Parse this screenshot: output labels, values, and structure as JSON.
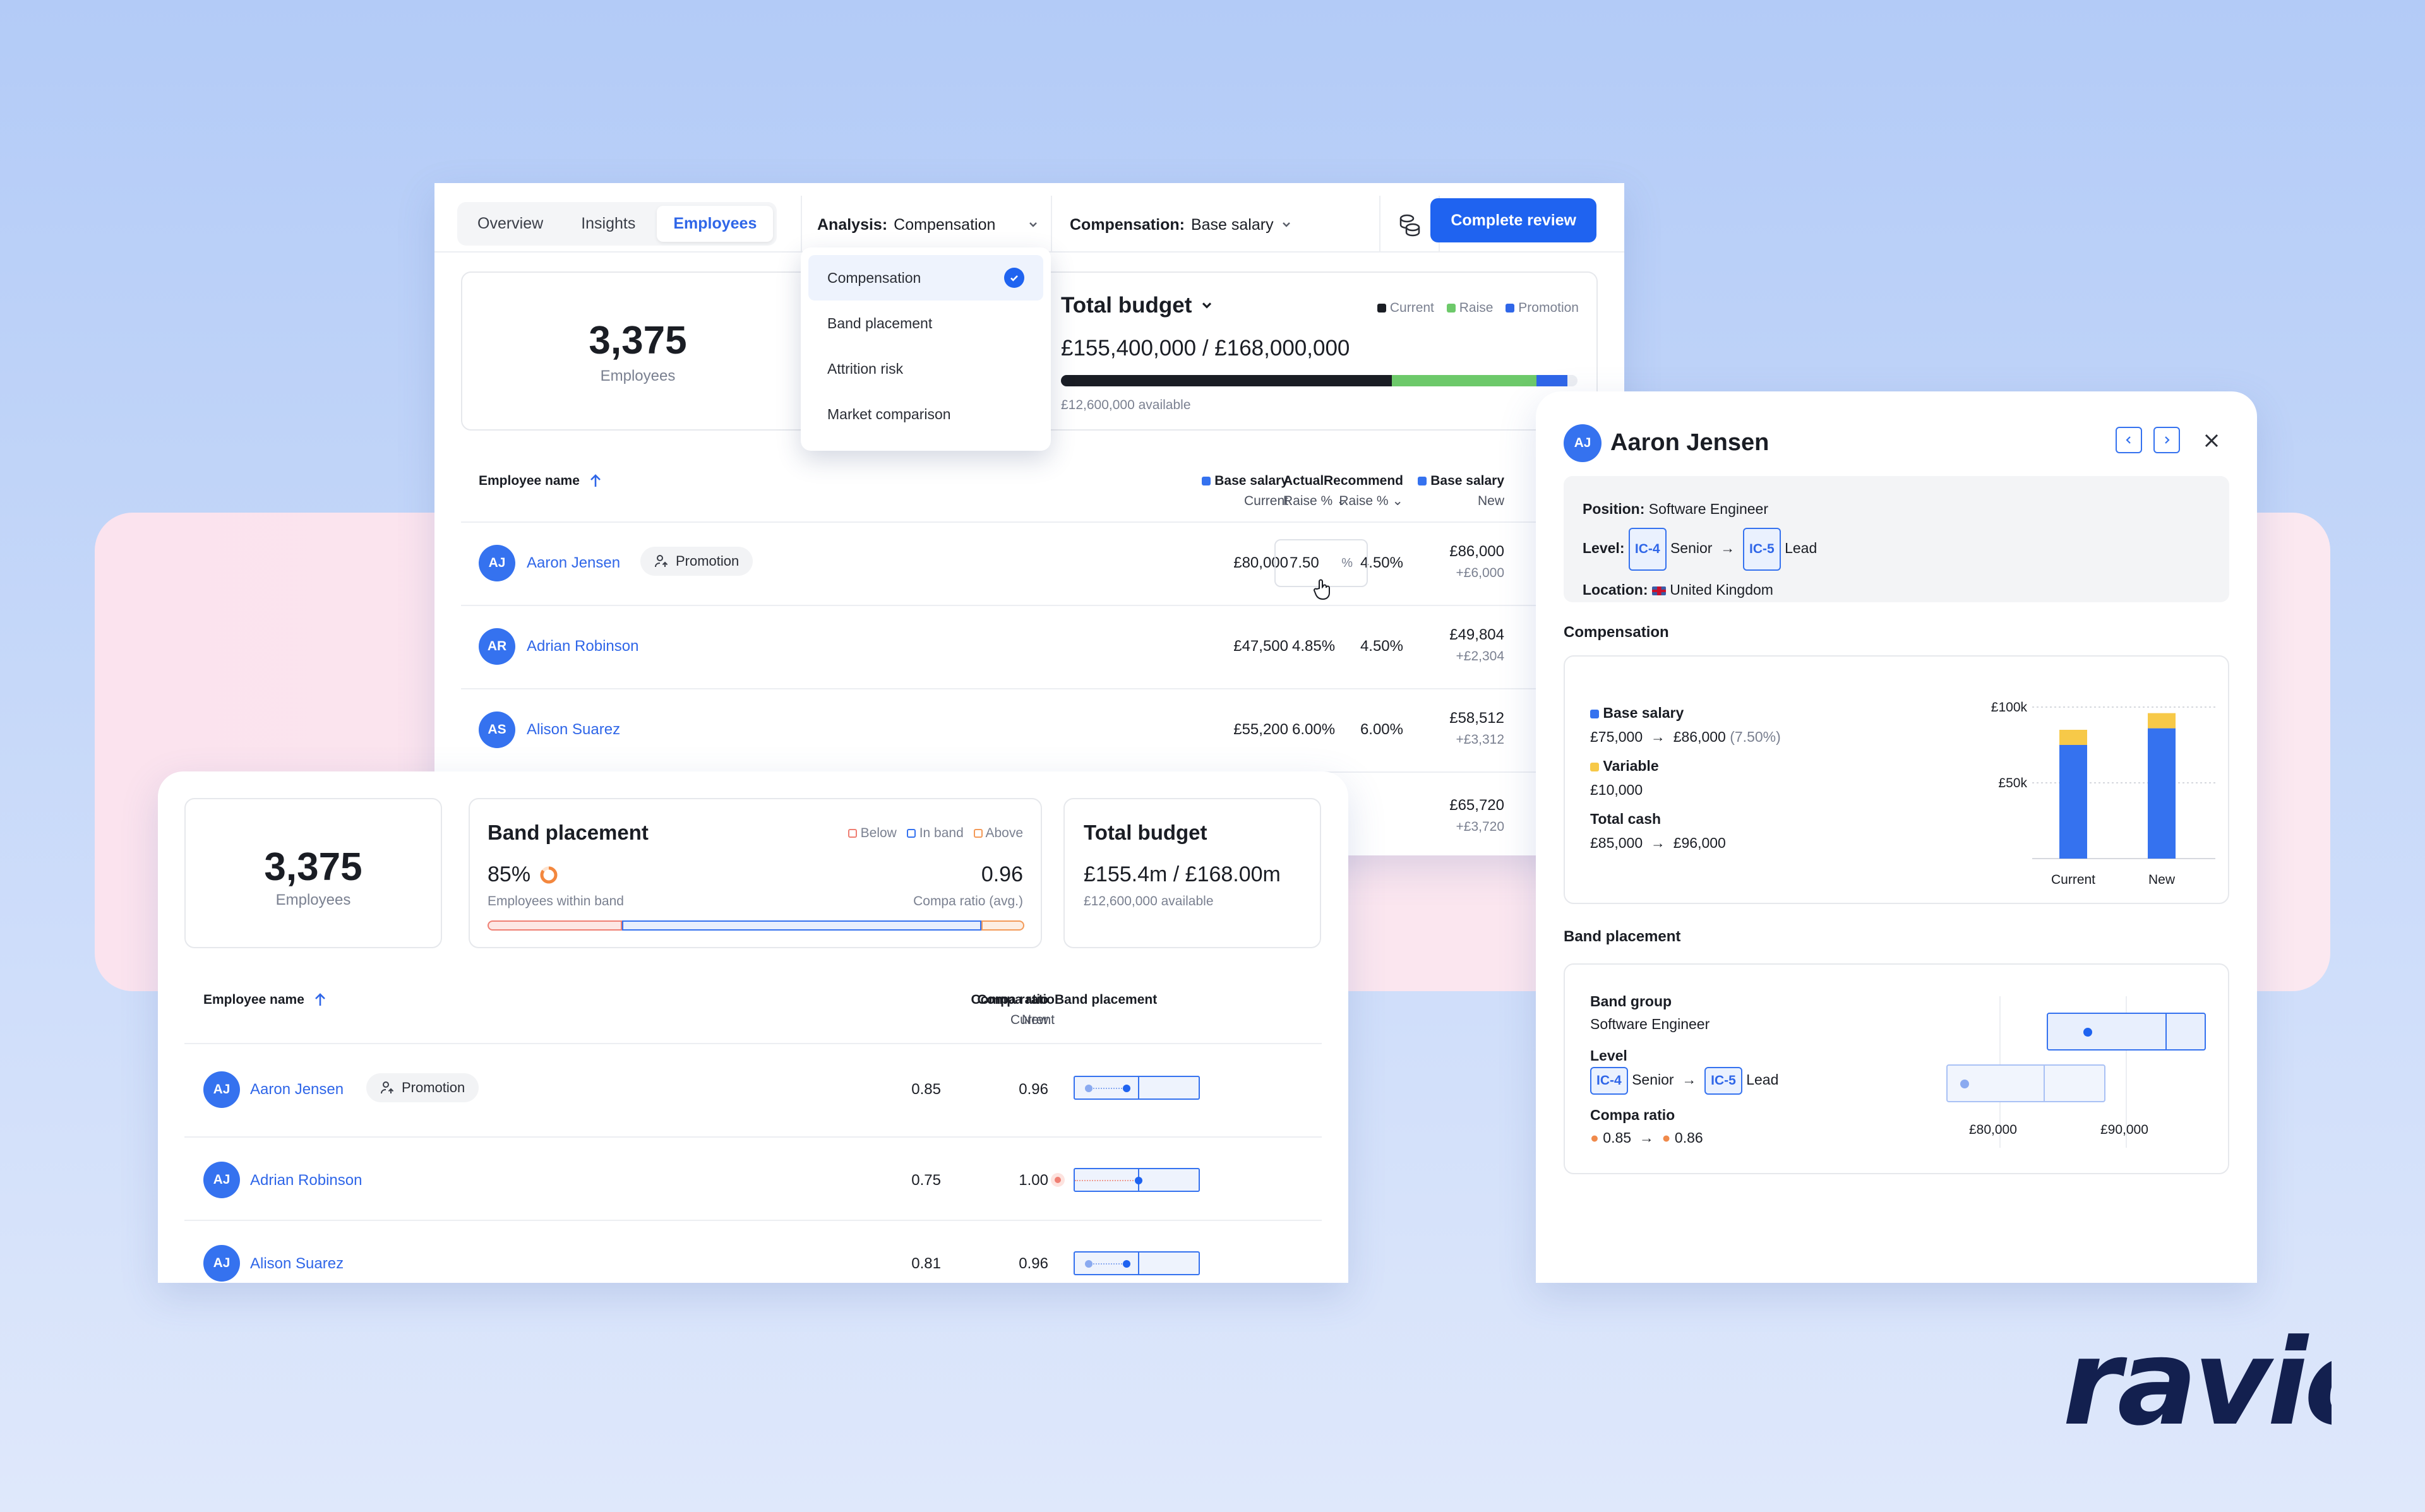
{
  "main": {
    "tabs": [
      "Overview",
      "Insights",
      "Employees"
    ],
    "active_tab": "Employees",
    "analysis_label": "Analysis:",
    "analysis_value": "Compensation",
    "compensation_label": "Compensation:",
    "compensation_value": "Base salary",
    "complete_button": "Complete review",
    "dropdown": [
      "Compensation",
      "Band placement",
      "Attrition risk",
      "Market comparison"
    ],
    "employees_count": "3,375",
    "employees_label": "Employees",
    "budget_title": "Total budget",
    "budget_amount": "£155,400,000 / £168,000,000",
    "budget_available": "£12,600,000 available",
    "legend": [
      "Current",
      "Raise",
      "Promotion"
    ],
    "budget_progress": {
      "current": 0.64,
      "raise": 0.28,
      "promotion": 0.06
    },
    "headers": {
      "name": "Employee name",
      "base_current_1": "Base salary",
      "base_current_2": "Current",
      "rec_1": "Recommend",
      "rec_2": "Raise %",
      "act_1": "Actual",
      "act_2": "Raise %",
      "base_new_1": "Base salary",
      "base_new_2": "New"
    },
    "rows": [
      {
        "initials": "AJ",
        "name": "Aaron Jensen",
        "badge": "Promotion",
        "current": "£80,000",
        "recommend": "4.50%",
        "actual": "7.50",
        "new": "£86,000",
        "delta": "+£6,000"
      },
      {
        "initials": "AR",
        "name": "Adrian Robinson",
        "current": "£47,500",
        "recommend": "4.50%",
        "actual": "4.85%",
        "new": "£49,804",
        "delta": "+£2,304"
      },
      {
        "initials": "AS",
        "name": "Alison Suarez",
        "current": "£55,200",
        "recommend": "6.00%",
        "actual": "6.00%",
        "new": "£58,512",
        "delta": "+£3,312"
      },
      {
        "new": "£65,720",
        "delta": "+£3,720"
      }
    ]
  },
  "band": {
    "employees_count": "3,375",
    "employees_label": "Employees",
    "placement_title": "Band placement",
    "placement_legend": [
      "Below",
      "In band",
      "Above"
    ],
    "within_pct": "85%",
    "within_label": "Employees within band",
    "compa_value": "0.96",
    "compa_label": "Compa ratio (avg.)",
    "budget_title": "Total budget",
    "budget_amount": "£155.4m / £168.00m",
    "budget_available": "£12,600,000 available",
    "headers": {
      "name": "Employee name",
      "cr_cur_1": "Compa ratio",
      "cr_cur_2": "Current",
      "cr_new_1": "Compa ratio",
      "cr_new_2": "New",
      "placement": "Band placement"
    },
    "rows": [
      {
        "initials": "AJ",
        "name": "Aaron Jensen",
        "badge": "Promotion",
        "current": "0.85",
        "new": "0.96"
      },
      {
        "initials": "AJ",
        "name": "Adrian Robinson",
        "current": "0.75",
        "new": "1.00"
      },
      {
        "initials": "AJ",
        "name": "Alison Suarez",
        "current": "0.81",
        "new": "0.96"
      }
    ]
  },
  "detail": {
    "initials": "AJ",
    "name": "Aaron Jensen",
    "position_label": "Position:",
    "position_value": "Software Engineer",
    "level_label": "Level:",
    "level_from_tag": "IC-4",
    "level_from": "Senior",
    "level_to_tag": "IC-5",
    "level_to": "Lead",
    "location_label": "Location:",
    "location_value": "United Kingdom",
    "compensation_title": "Compensation",
    "base_label": "Base salary",
    "base_from": "£75,000",
    "base_to": "£86,000",
    "base_pct": "(7.50%)",
    "variable_label": "Variable",
    "variable_value": "£10,000",
    "total_label": "Total cash",
    "total_from": "£85,000",
    "total_to": "£96,000",
    "band_title": "Band placement",
    "band_group_label": "Band group",
    "band_group_value": "Software Engineer",
    "level2_label": "Level",
    "compa_label": "Compa ratio",
    "compa_from": "0.85",
    "compa_to": "0.86",
    "axis_80": "£80,000",
    "axis_90": "£90,000"
  },
  "chart_data": {
    "type": "bar",
    "categories": [
      "Current",
      "New"
    ],
    "series": [
      {
        "name": "Base salary",
        "values": [
          75000,
          86000
        ]
      },
      {
        "name": "Variable",
        "values": [
          10000,
          10000
        ]
      }
    ],
    "yticks": [
      "£50k",
      "£100k"
    ],
    "ylim": [
      0,
      100000
    ],
    "colors": {
      "Base salary": "#3572ef",
      "Variable": "#f7c948"
    }
  },
  "brand": {
    "logo_text": "ravio"
  },
  "colors": {
    "accent": "#1f63f0",
    "current": "#1a1d24",
    "raise": "#6dc96a",
    "promotion": "#2f66e8"
  }
}
